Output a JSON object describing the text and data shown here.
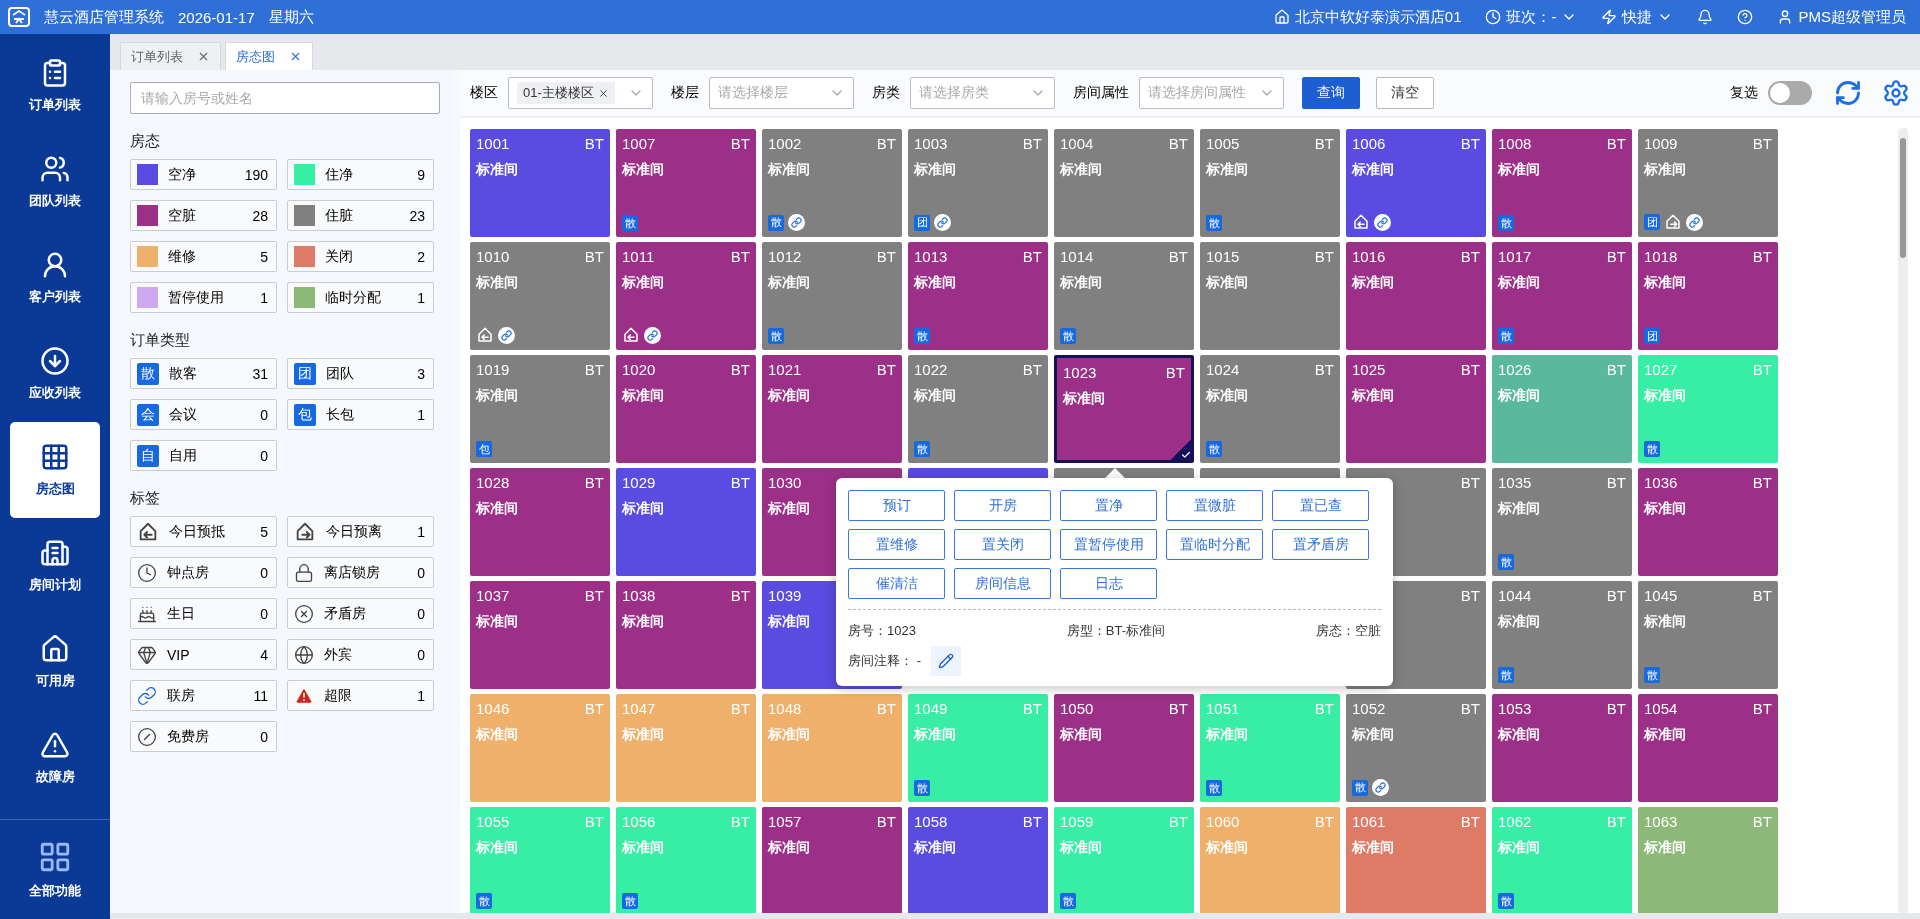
{
  "header": {
    "app_name": "慧云酒店管理系统",
    "date": "2026-01-17",
    "weekday": "星期六",
    "hotel": "北京中软好泰演示酒店01",
    "shift": "班次：-",
    "quick": "快捷",
    "user": "PMS超级管理员"
  },
  "nav": [
    {
      "label": "订单列表",
      "selected": false
    },
    {
      "label": "团队列表",
      "selected": false
    },
    {
      "label": "客户列表",
      "selected": false
    },
    {
      "label": "应收列表",
      "selected": false
    },
    {
      "label": "房态图",
      "selected": true
    },
    {
      "label": "房间计划",
      "selected": false
    },
    {
      "label": "可用房",
      "selected": false
    },
    {
      "label": "故障房",
      "selected": false
    }
  ],
  "nav_bottom": {
    "label": "全部功能"
  },
  "tabs": [
    {
      "label": "订单列表",
      "selected": false
    },
    {
      "label": "房态图",
      "selected": true
    }
  ],
  "search": {
    "placeholder": "请输入房号或姓名"
  },
  "room_status": {
    "title": "房态",
    "items": [
      {
        "label": "空净",
        "count": "190",
        "color": "#5a4ce0"
      },
      {
        "label": "住净",
        "count": "9",
        "color": "#38eea4"
      },
      {
        "label": "空脏",
        "count": "28",
        "color": "#9c3088"
      },
      {
        "label": "住脏",
        "count": "23",
        "color": "#808080"
      },
      {
        "label": "维修",
        "count": "5",
        "color": "#eeb06a"
      },
      {
        "label": "关闭",
        "count": "2",
        "color": "#de7b66"
      },
      {
        "label": "暂停使用",
        "count": "1",
        "color": "#d0a8f0"
      },
      {
        "label": "临时分配",
        "count": "1",
        "color": "#8cb878"
      }
    ]
  },
  "order_types": {
    "title": "订单类型",
    "items": [
      {
        "badge": "散",
        "label": "散客",
        "count": "31"
      },
      {
        "badge": "团",
        "label": "团队",
        "count": "3"
      },
      {
        "badge": "会",
        "label": "会议",
        "count": "0"
      },
      {
        "badge": "包",
        "label": "长包",
        "count": "1"
      },
      {
        "badge": "自",
        "label": "自用",
        "count": "0"
      }
    ]
  },
  "tags": {
    "title": "标签",
    "items": [
      {
        "kind": "arrive",
        "label": "今日预抵",
        "count": "5"
      },
      {
        "kind": "depart",
        "label": "今日预离",
        "count": "1"
      },
      {
        "kind": "hourly",
        "label": "钟点房",
        "count": "0"
      },
      {
        "kind": "lock",
        "label": "离店锁房",
        "count": "0"
      },
      {
        "kind": "birthday",
        "label": "生日",
        "count": "0"
      },
      {
        "kind": "conflict",
        "label": "矛盾房",
        "count": "0"
      },
      {
        "kind": "vip",
        "label": "VIP",
        "count": "4"
      },
      {
        "kind": "foreign",
        "label": "外宾",
        "count": "0"
      },
      {
        "kind": "link",
        "label": "联房",
        "count": "11"
      },
      {
        "kind": "overlimit",
        "label": "超限",
        "count": "1"
      },
      {
        "kind": "free",
        "label": "免费房",
        "count": "0"
      }
    ]
  },
  "filters": [
    {
      "label": "楼区",
      "tag": "01-主楼楼区"
    },
    {
      "label": "楼层",
      "placeholder": "请选择楼层"
    },
    {
      "label": "房类",
      "placeholder": "请选择房类"
    },
    {
      "label": "房间属性",
      "placeholder": "请选择房间属性"
    }
  ],
  "buttons": [
    {
      "label": "查询",
      "kind": "primary"
    },
    {
      "label": "清空",
      "kind": "default"
    }
  ],
  "multi_select": {
    "label": "复选",
    "on": false
  },
  "rooms": [
    {
      "kind": "room",
      "number": "1001",
      "type_code": "BT",
      "name": "标准间",
      "color": "#5a4ce0",
      "selected": false
    },
    {
      "kind": "room",
      "number": "1007",
      "type_code": "BT",
      "name": "标准间",
      "color": "#9c3088",
      "selected": false,
      "badges": [
        {
          "kind": "order",
          "text": "散"
        }
      ]
    },
    {
      "kind": "room",
      "number": "1002",
      "type_code": "BT",
      "name": "标准间",
      "color": "#808080",
      "selected": false,
      "badges": [
        {
          "kind": "order",
          "text": "散"
        },
        {
          "kind": "link"
        }
      ]
    },
    {
      "kind": "room",
      "number": "1003",
      "type_code": "BT",
      "name": "标准间",
      "color": "#808080",
      "selected": false,
      "badges": [
        {
          "kind": "order",
          "text": "团"
        },
        {
          "kind": "link"
        }
      ]
    },
    {
      "kind": "room",
      "number": "1004",
      "type_code": "BT",
      "name": "标准间",
      "color": "#808080",
      "selected": false
    },
    {
      "kind": "room",
      "number": "1005",
      "type_code": "BT",
      "name": "标准间",
      "color": "#808080",
      "selected": false,
      "badges": [
        {
          "kind": "order",
          "text": "散"
        }
      ]
    },
    {
      "kind": "room",
      "number": "1006",
      "type_code": "BT",
      "name": "标准间",
      "color": "#5a4ce0",
      "selected": false,
      "badges": [
        {
          "kind": "arrive"
        },
        {
          "kind": "link"
        }
      ]
    },
    {
      "kind": "room",
      "number": "1008",
      "type_code": "BT",
      "name": "标准间",
      "color": "#9c3088",
      "selected": false,
      "badges": [
        {
          "kind": "order",
          "text": "散"
        }
      ]
    },
    {
      "kind": "room",
      "number": "1009",
      "type_code": "BT",
      "name": "标准间",
      "color": "#808080",
      "selected": false,
      "badges": [
        {
          "kind": "order",
          "text": "团"
        },
        {
          "kind": "depart"
        },
        {
          "kind": "link"
        }
      ]
    },
    {
      "kind": "room",
      "number": "1010",
      "type_code": "BT",
      "name": "标准间",
      "color": "#808080",
      "selected": false,
      "badges": [
        {
          "kind": "arrive"
        },
        {
          "kind": "link"
        }
      ]
    },
    {
      "kind": "room",
      "number": "1011",
      "type_code": "BT",
      "name": "标准间",
      "color": "#9c3088",
      "selected": false,
      "badges": [
        {
          "kind": "arrive"
        },
        {
          "kind": "link"
        }
      ]
    },
    {
      "kind": "room",
      "number": "1012",
      "type_code": "BT",
      "name": "标准间",
      "color": "#808080",
      "selected": false,
      "badges": [
        {
          "kind": "order",
          "text": "散"
        }
      ]
    },
    {
      "kind": "room",
      "number": "1013",
      "type_code": "BT",
      "name": "标准间",
      "color": "#9c3088",
      "selected": false,
      "badges": [
        {
          "kind": "order",
          "text": "散"
        }
      ]
    },
    {
      "kind": "room",
      "number": "1014",
      "type_code": "BT",
      "name": "标准间",
      "color": "#808080",
      "selected": false,
      "badges": [
        {
          "kind": "order",
          "text": "散"
        }
      ]
    },
    {
      "kind": "room",
      "number": "1015",
      "type_code": "BT",
      "name": "标准间",
      "color": "#808080",
      "selected": false
    },
    {
      "kind": "room",
      "number": "1016",
      "type_code": "BT",
      "name": "标准间",
      "color": "#9c3088",
      "selected": false
    },
    {
      "kind": "room",
      "number": "1017",
      "type_code": "BT",
      "name": "标准间",
      "color": "#9c3088",
      "selected": false,
      "badges": [
        {
          "kind": "order",
          "text": "散"
        }
      ]
    },
    {
      "kind": "room",
      "number": "1018",
      "type_code": "BT",
      "name": "标准间",
      "color": "#9c3088",
      "selected": false,
      "badges": [
        {
          "kind": "order",
          "text": "团"
        }
      ]
    },
    {
      "kind": "room",
      "number": "1019",
      "type_code": "BT",
      "name": "标准间",
      "color": "#808080",
      "selected": false,
      "badges": [
        {
          "kind": "order",
          "text": "包"
        }
      ]
    },
    {
      "kind": "room",
      "number": "1020",
      "type_code": "BT",
      "name": "标准间",
      "color": "#9c3088",
      "selected": false
    },
    {
      "kind": "room",
      "number": "1021",
      "type_code": "BT",
      "name": "标准间",
      "color": "#9c3088",
      "selected": false
    },
    {
      "kind": "room",
      "number": "1022",
      "type_code": "BT",
      "name": "标准间",
      "color": "#808080",
      "selected": false,
      "badges": [
        {
          "kind": "order",
          "text": "散"
        }
      ]
    },
    {
      "kind": "room",
      "number": "1023",
      "type_code": "BT",
      "name": "标准间",
      "color": "#9c3088",
      "selected": true
    },
    {
      "kind": "room",
      "number": "1024",
      "type_code": "BT",
      "name": "标准间",
      "color": "#808080",
      "selected": false,
      "badges": [
        {
          "kind": "order",
          "text": "散"
        }
      ]
    },
    {
      "kind": "room",
      "number": "1025",
      "type_code": "BT",
      "name": "标准间",
      "color": "#9c3088",
      "selected": false
    },
    {
      "kind": "room",
      "number": "1026",
      "type_code": "BT",
      "name": "标准间",
      "color": "#5ab89c",
      "selected": false
    },
    {
      "kind": "room",
      "number": "1027",
      "type_code": "BT",
      "name": "标准间",
      "color": "#38eea4",
      "selected": false,
      "badges": [
        {
          "kind": "order",
          "text": "散"
        }
      ]
    },
    {
      "kind": "room",
      "number": "1028",
      "type_code": "BT",
      "name": "标准间",
      "color": "#9c3088",
      "selected": false
    },
    {
      "kind": "room",
      "number": "1029",
      "type_code": "BT",
      "name": "标准间",
      "color": "#5a4ce0",
      "selected": false
    },
    {
      "kind": "room",
      "number": "1030",
      "name": "标准间",
      "color": "#9c3088",
      "selected": false
    },
    {
      "kind": "room",
      "color": "#5a4ce0",
      "selected": false
    },
    {
      "kind": "room",
      "color": "#808080",
      "selected": false
    },
    {
      "kind": "room",
      "color": "#808080",
      "selected": false
    },
    {
      "kind": "room",
      "type_code": "BT",
      "color": "#808080",
      "selected": false
    },
    {
      "kind": "room",
      "number": "1035",
      "type_code": "BT",
      "name": "标准间",
      "color": "#808080",
      "selected": false,
      "badges": [
        {
          "kind": "order",
          "text": "散"
        }
      ]
    },
    {
      "kind": "room",
      "number": "1036",
      "type_code": "BT",
      "name": "标准间",
      "color": "#9c3088",
      "selected": false
    },
    {
      "kind": "room",
      "number": "1037",
      "type_code": "BT",
      "name": "标准间",
      "color": "#9c3088",
      "selected": false
    },
    {
      "kind": "room",
      "number": "1038",
      "type_code": "BT",
      "name": "标准间",
      "color": "#9c3088",
      "selected": false
    },
    {
      "kind": "room",
      "number": "1039",
      "name": "标准间",
      "color": "#5a4ce0",
      "selected": false
    },
    {
      "kind": "hidden"
    },
    {
      "kind": "hidden"
    },
    {
      "kind": "hidden"
    },
    {
      "kind": "room",
      "type_code": "BT",
      "color": "#808080",
      "selected": false
    },
    {
      "kind": "room",
      "number": "1044",
      "type_code": "BT",
      "name": "标准间",
      "color": "#808080",
      "selected": false,
      "badges": [
        {
          "kind": "order",
          "text": "散"
        }
      ]
    },
    {
      "kind": "room",
      "number": "1045",
      "type_code": "BT",
      "name": "标准间",
      "color": "#808080",
      "selected": false,
      "badges": [
        {
          "kind": "order",
          "text": "散"
        }
      ]
    },
    {
      "kind": "room",
      "number": "1046",
      "type_code": "BT",
      "name": "标准间",
      "color": "#eeb06a",
      "selected": false
    },
    {
      "kind": "room",
      "number": "1047",
      "type_code": "BT",
      "name": "标准间",
      "color": "#eeb06a",
      "selected": false
    },
    {
      "kind": "room",
      "number": "1048",
      "type_code": "BT",
      "name": "标准间",
      "color": "#eeb06a",
      "selected": false
    },
    {
      "kind": "room",
      "number": "1049",
      "type_code": "BT",
      "name": "标准间",
      "color": "#38eea4",
      "selected": false,
      "badges": [
        {
          "kind": "order",
          "text": "散"
        }
      ]
    },
    {
      "kind": "room",
      "number": "1050",
      "type_code": "BT",
      "name": "标准间",
      "color": "#9c3088",
      "selected": false
    },
    {
      "kind": "room",
      "number": "1051",
      "type_code": "BT",
      "name": "标准间",
      "color": "#38eea4",
      "selected": false,
      "badges": [
        {
          "kind": "order",
          "text": "散"
        }
      ]
    },
    {
      "kind": "room",
      "number": "1052",
      "type_code": "BT",
      "name": "标准间",
      "color": "#808080",
      "selected": false,
      "badges": [
        {
          "kind": "order",
          "text": "散"
        },
        {
          "kind": "link"
        }
      ]
    },
    {
      "kind": "room",
      "number": "1053",
      "type_code": "BT",
      "name": "标准间",
      "color": "#9c3088",
      "selected": false
    },
    {
      "kind": "room",
      "number": "1054",
      "type_code": "BT",
      "name": "标准间",
      "color": "#9c3088",
      "selected": false
    },
    {
      "kind": "room",
      "number": "1055",
      "type_code": "BT",
      "name": "标准间",
      "color": "#38eea4",
      "selected": false,
      "badges": [
        {
          "kind": "order",
          "text": "散"
        }
      ]
    },
    {
      "kind": "room",
      "number": "1056",
      "type_code": "BT",
      "name": "标准间",
      "color": "#38eea4",
      "selected": false,
      "badges": [
        {
          "kind": "order",
          "text": "散"
        }
      ]
    },
    {
      "kind": "room",
      "number": "1057",
      "type_code": "BT",
      "name": "标准间",
      "color": "#9c3088",
      "selected": false
    },
    {
      "kind": "room",
      "number": "1058",
      "type_code": "BT",
      "name": "标准间",
      "color": "#5a4ce0",
      "selected": false
    },
    {
      "kind": "room",
      "number": "1059",
      "type_code": "BT",
      "name": "标准间",
      "color": "#38eea4",
      "selected": false,
      "badges": [
        {
          "kind": "order",
          "text": "散"
        }
      ]
    },
    {
      "kind": "room",
      "number": "1060",
      "type_code": "BT",
      "name": "标准间",
      "color": "#eeb06a",
      "selected": false
    },
    {
      "kind": "room",
      "number": "1061",
      "type_code": "BT",
      "name": "标准间",
      "color": "#de7b66",
      "selected": false
    },
    {
      "kind": "room",
      "number": "1062",
      "type_code": "BT",
      "name": "标准间",
      "color": "#38eea4",
      "selected": false,
      "badges": [
        {
          "kind": "order",
          "text": "散"
        }
      ]
    },
    {
      "kind": "room",
      "number": "1063",
      "type_code": "BT",
      "name": "标准间",
      "color": "#8cb878",
      "selected": false
    }
  ],
  "popup": {
    "actions": [
      "预订",
      "开房",
      "置净",
      "置微脏",
      "置已查",
      "置维修",
      "置关闭",
      "置暂停使用",
      "置临时分配",
      "置矛盾房",
      "催清洁",
      "房间信息",
      "日志"
    ],
    "info": [
      {
        "label": "房号：",
        "value": "1023"
      },
      {
        "label": "房型：",
        "value": "BT-标准间"
      },
      {
        "label": "房态：",
        "value": "空脏"
      }
    ],
    "note": {
      "label": "房间注释：",
      "value": "-"
    }
  }
}
